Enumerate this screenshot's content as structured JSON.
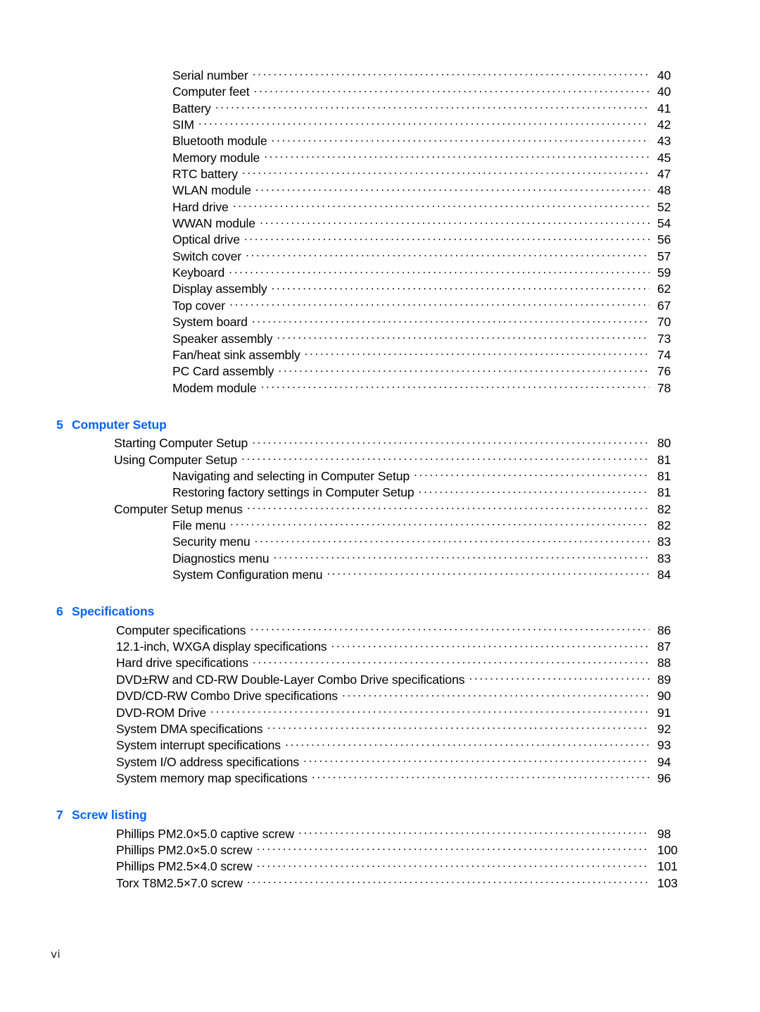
{
  "document": {
    "type": "table-of-contents",
    "folio": "vi",
    "heading_color": "#0A64F0",
    "text_color": "#1a1a1a"
  },
  "blocks": [
    {
      "kind": "entries",
      "heading": null,
      "entries": [
        {
          "label": "Serial number",
          "page": "40",
          "level": 2
        },
        {
          "label": "Computer feet",
          "page": "40",
          "level": 2
        },
        {
          "label": "Battery",
          "page": "41",
          "level": 2
        },
        {
          "label": "SIM",
          "page": "42",
          "level": 2
        },
        {
          "label": "Bluetooth module",
          "page": "43",
          "level": 2
        },
        {
          "label": "Memory module",
          "page": "45",
          "level": 2
        },
        {
          "label": "RTC battery",
          "page": "47",
          "level": 2
        },
        {
          "label": "WLAN module",
          "page": "48",
          "level": 2
        },
        {
          "label": "Hard drive",
          "page": "52",
          "level": 2
        },
        {
          "label": "WWAN module",
          "page": "54",
          "level": 2
        },
        {
          "label": "Optical drive",
          "page": "56",
          "level": 2
        },
        {
          "label": "Switch cover",
          "page": "57",
          "level": 2
        },
        {
          "label": "Keyboard",
          "page": "59",
          "level": 2
        },
        {
          "label": "Display assembly",
          "page": "62",
          "level": 2
        },
        {
          "label": "Top cover",
          "page": "67",
          "level": 2
        },
        {
          "label": "System board",
          "page": "70",
          "level": 2
        },
        {
          "label": "Speaker assembly",
          "page": "73",
          "level": 2
        },
        {
          "label": "Fan/heat sink assembly",
          "page": "74",
          "level": 2
        },
        {
          "label": "PC Card assembly",
          "page": "76",
          "level": 2
        },
        {
          "label": "Modem module",
          "page": "78",
          "level": 2
        }
      ]
    },
    {
      "kind": "section",
      "heading": {
        "number": "5",
        "title": "Computer Setup"
      },
      "entries": [
        {
          "label": "Starting Computer Setup",
          "page": "80",
          "level": 1
        },
        {
          "label": "Using Computer Setup",
          "page": "81",
          "level": 1
        },
        {
          "label": "Navigating and selecting in Computer Setup",
          "page": "81",
          "level": 2
        },
        {
          "label": "Restoring factory settings in Computer Setup",
          "page": "81",
          "level": 2
        },
        {
          "label": "Computer Setup menus",
          "page": "82",
          "level": 1
        },
        {
          "label": "File menu",
          "page": "82",
          "level": 2
        },
        {
          "label": "Security menu",
          "page": "83",
          "level": 2
        },
        {
          "label": "Diagnostics menu",
          "page": "83",
          "level": 2
        },
        {
          "label": "System Configuration menu",
          "page": "84",
          "level": 2
        }
      ]
    },
    {
      "kind": "section",
      "heading": {
        "number": "6",
        "title": "Specifications"
      },
      "entries": [
        {
          "label": "Computer specifications",
          "page": "86",
          "level": 1
        },
        {
          "label": "12.1-inch, WXGA display specifications",
          "page": "87",
          "level": 1
        },
        {
          "label": "Hard drive specifications",
          "page": "88",
          "level": 1
        },
        {
          "label": "DVD±RW and CD-RW Double-Layer Combo Drive specifications",
          "page": "89",
          "level": 1
        },
        {
          "label": "DVD/CD-RW Combo Drive specifications",
          "page": "90",
          "level": 1
        },
        {
          "label": "DVD-ROM Drive",
          "page": "91",
          "level": 1
        },
        {
          "label": "System DMA specifications",
          "page": "92",
          "level": 1
        },
        {
          "label": "System interrupt specifications",
          "page": "93",
          "level": 1
        },
        {
          "label": "System I/O address specifications",
          "page": "94",
          "level": 1
        },
        {
          "label": "System memory map specifications",
          "page": "96",
          "level": 1
        }
      ]
    },
    {
      "kind": "section",
      "heading": {
        "number": "7",
        "title": "Screw listing"
      },
      "entries": [
        {
          "label": "Phillips PM2.0×5.0 captive screw",
          "page": "98",
          "level": 1
        },
        {
          "label": "Phillips PM2.0×5.0 screw",
          "page": "100",
          "level": 1
        },
        {
          "label": "Phillips PM2.5×4.0 screw",
          "page": "101",
          "level": 1
        },
        {
          "label": "Torx T8M2.5×7.0 screw",
          "page": "103",
          "level": 1
        }
      ]
    }
  ]
}
